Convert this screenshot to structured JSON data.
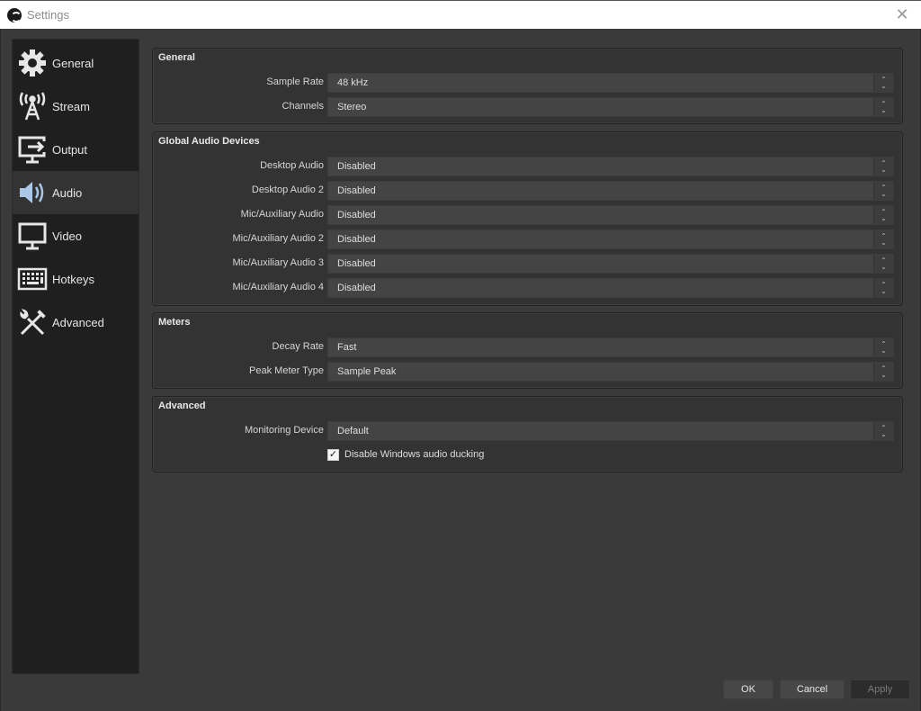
{
  "window": {
    "title": "Settings",
    "close_icon": "close-icon"
  },
  "sidebar": {
    "items": [
      {
        "label": "General",
        "icon": "gear-icon",
        "active": false
      },
      {
        "label": "Stream",
        "icon": "broadcast-tower-icon",
        "active": false
      },
      {
        "label": "Output",
        "icon": "output-monitor-icon",
        "active": false
      },
      {
        "label": "Audio",
        "icon": "speaker-icon",
        "active": true
      },
      {
        "label": "Video",
        "icon": "monitor-icon",
        "active": false
      },
      {
        "label": "Hotkeys",
        "icon": "keyboard-icon",
        "active": false
      },
      {
        "label": "Advanced",
        "icon": "wrench-screwdriver-icon",
        "active": false
      }
    ]
  },
  "groups": {
    "general": {
      "title": "General",
      "rows": [
        {
          "label": "Sample Rate",
          "value": "48 kHz"
        },
        {
          "label": "Channels",
          "value": "Stereo"
        }
      ]
    },
    "global_audio": {
      "title": "Global Audio Devices",
      "rows": [
        {
          "label": "Desktop Audio",
          "value": "Disabled"
        },
        {
          "label": "Desktop Audio 2",
          "value": "Disabled"
        },
        {
          "label": "Mic/Auxiliary Audio",
          "value": "Disabled"
        },
        {
          "label": "Mic/Auxiliary Audio 2",
          "value": "Disabled"
        },
        {
          "label": "Mic/Auxiliary Audio 3",
          "value": "Disabled"
        },
        {
          "label": "Mic/Auxiliary Audio 4",
          "value": "Disabled"
        }
      ]
    },
    "meters": {
      "title": "Meters",
      "rows": [
        {
          "label": "Decay Rate",
          "value": "Fast"
        },
        {
          "label": "Peak Meter Type",
          "value": "Sample Peak"
        }
      ]
    },
    "advanced": {
      "title": "Advanced",
      "rows": [
        {
          "label": "Monitoring Device",
          "value": "Default"
        }
      ],
      "checkbox": {
        "label": "Disable Windows audio ducking",
        "checked": true,
        "mark": "✓"
      }
    }
  },
  "spin": {
    "up": "⌃",
    "down": "⌄"
  },
  "buttons": {
    "ok": "OK",
    "cancel": "Cancel",
    "apply": "Apply"
  },
  "colors": {
    "background": "#3a3a3a",
    "sidebar": "#1f1f1f",
    "sidebar_active": "#333333",
    "group": "#333333",
    "combo": "#444444",
    "audio_icon_accent": "#a9c8e8"
  }
}
